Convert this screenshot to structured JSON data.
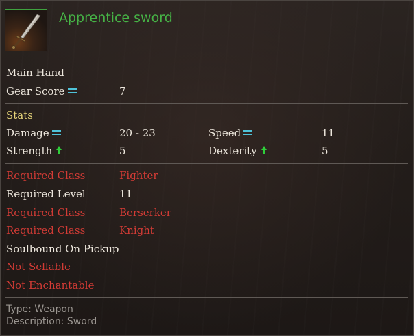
{
  "item": {
    "name": "Apprentice sword",
    "icon": "sword-icon",
    "slot": "Main Hand"
  },
  "gear_score": {
    "label": "Gear Score",
    "value": "7",
    "compare_icon": "equal-icon"
  },
  "stats": {
    "header": "Stats",
    "damage": {
      "label": "Damage",
      "value": "20 - 23",
      "compare_icon": "equal-icon"
    },
    "speed": {
      "label": "Speed",
      "value": "11",
      "compare_icon": "equal-icon"
    },
    "strength": {
      "label": "Strength",
      "value": "5",
      "compare_icon": "arrow-up-icon"
    },
    "dexterity": {
      "label": "Dexterity",
      "value": "5",
      "compare_icon": "arrow-up-icon"
    }
  },
  "requirements": [
    {
      "label": "Required Class",
      "value": "Fighter",
      "met": false
    },
    {
      "label": "Required Level",
      "value": "11",
      "met": true
    },
    {
      "label": "Required Class",
      "value": "Berserker",
      "met": false
    },
    {
      "label": "Required Class",
      "value": "Knight",
      "met": false
    }
  ],
  "flags": {
    "soulbound": "Soulbound On Pickup",
    "not_sellable": "Not Sellable",
    "not_enchantable": "Not Enchantable"
  },
  "footer": {
    "type": "Type: Weapon",
    "description": "Description: Sword"
  },
  "colors": {
    "item_name": "#46b346",
    "requirement_unmet": "#d23b35",
    "section_header": "#e8d67a",
    "compare_equal": "#4fc3d9",
    "compare_up": "#2fce3a"
  }
}
